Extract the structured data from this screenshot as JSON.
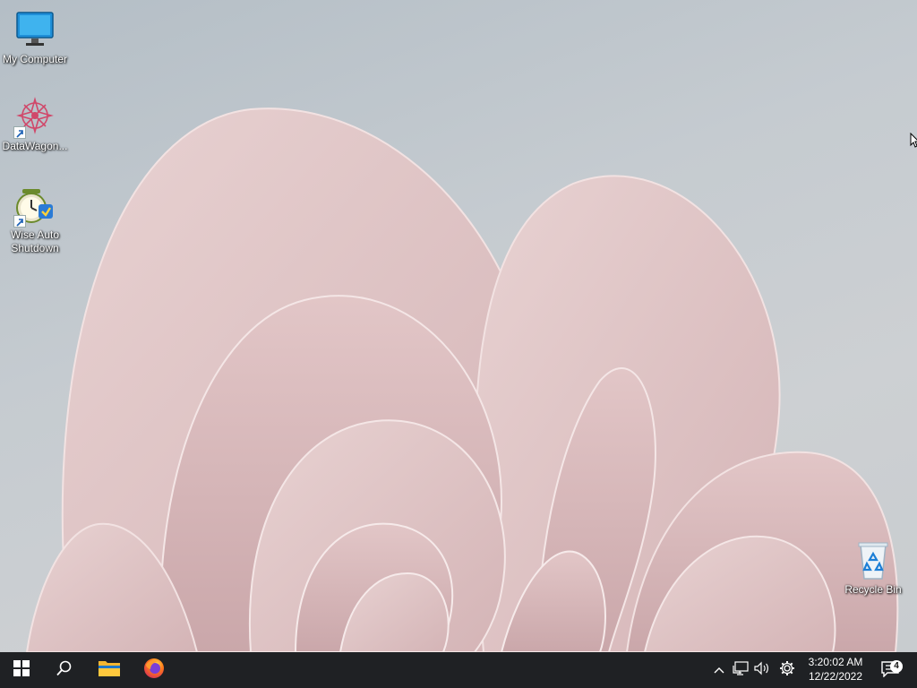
{
  "desktop": {
    "icons": [
      {
        "label": "My Computer",
        "icon": "monitor-icon"
      },
      {
        "label": "DataWagon...",
        "icon": "datawagon-icon",
        "shortcut": true
      },
      {
        "label": "Wise Auto Shutdown",
        "icon": "wise-auto-shutdown-icon",
        "shortcut": true
      },
      {
        "label": "Recycle Bin",
        "icon": "recycle-bin-icon"
      }
    ]
  },
  "taskbar": {
    "pinned": [
      {
        "name": "start",
        "icon": "windows-logo-icon"
      },
      {
        "name": "search",
        "icon": "search-icon"
      },
      {
        "name": "file-explorer",
        "icon": "folder-icon"
      },
      {
        "name": "firefox",
        "icon": "firefox-icon"
      }
    ],
    "tray": {
      "icons": [
        "chevron-up-icon",
        "network-icon",
        "volume-icon",
        "gear-icon"
      ],
      "time": "3:20:02 AM",
      "date": "12/22/2022",
      "notification_count": "4"
    }
  },
  "colors": {
    "taskbar": "#1f2124",
    "accent": "#0078d4",
    "wallpaper_petal": "#e6cccc"
  }
}
